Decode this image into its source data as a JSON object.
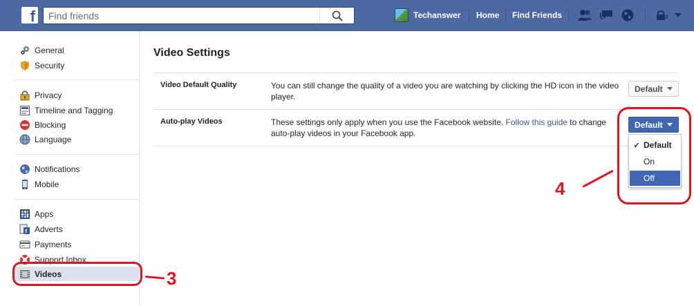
{
  "header": {
    "search_placeholder": "Find friends",
    "profile_name": "Techanswer",
    "nav": {
      "home": "Home",
      "find_friends": "Find Friends"
    }
  },
  "sidebar": {
    "groups": [
      [
        {
          "label": "General",
          "icon": "gears-icon"
        },
        {
          "label": "Security",
          "icon": "shield-icon"
        }
      ],
      [
        {
          "label": "Privacy",
          "icon": "lock-icon"
        },
        {
          "label": "Timeline and Tagging",
          "icon": "timeline-icon"
        },
        {
          "label": "Blocking",
          "icon": "block-icon"
        },
        {
          "label": "Language",
          "icon": "globe-icon"
        }
      ],
      [
        {
          "label": "Notifications",
          "icon": "globe-icon"
        },
        {
          "label": "Mobile",
          "icon": "mobile-icon"
        }
      ],
      [
        {
          "label": "Apps",
          "icon": "apps-icon"
        },
        {
          "label": "Adverts",
          "icon": "adverts-icon"
        },
        {
          "label": "Payments",
          "icon": "card-icon"
        },
        {
          "label": "Support Inbox",
          "icon": "lifebuoy-icon"
        },
        {
          "label": "Videos",
          "icon": "film-icon",
          "active": true
        }
      ]
    ]
  },
  "main": {
    "title": "Video Settings",
    "rows": [
      {
        "label": "Video Default Quality",
        "description": "You can still change the quality of a video you are watching by clicking the HD icon in the video player.",
        "button": "Default"
      },
      {
        "label": "Auto-play Videos",
        "description_before": "These settings only apply when you use the Facebook website. ",
        "link": "Follow this guide",
        "description_after": " to change auto-play videos in your Facebook app.",
        "button": "Default"
      }
    ],
    "dropdown": {
      "options": [
        {
          "label": "Default",
          "selected": true,
          "mark": "✓"
        },
        {
          "label": "On",
          "selected": false
        },
        {
          "label": "Off",
          "highlighted": true
        }
      ]
    }
  },
  "annotations": {
    "step_a": "3",
    "step_b": "4"
  },
  "colors": {
    "header": "#4e69a2",
    "accent": "#4267b2",
    "link": "#365899",
    "annotation": "#e0141e"
  }
}
